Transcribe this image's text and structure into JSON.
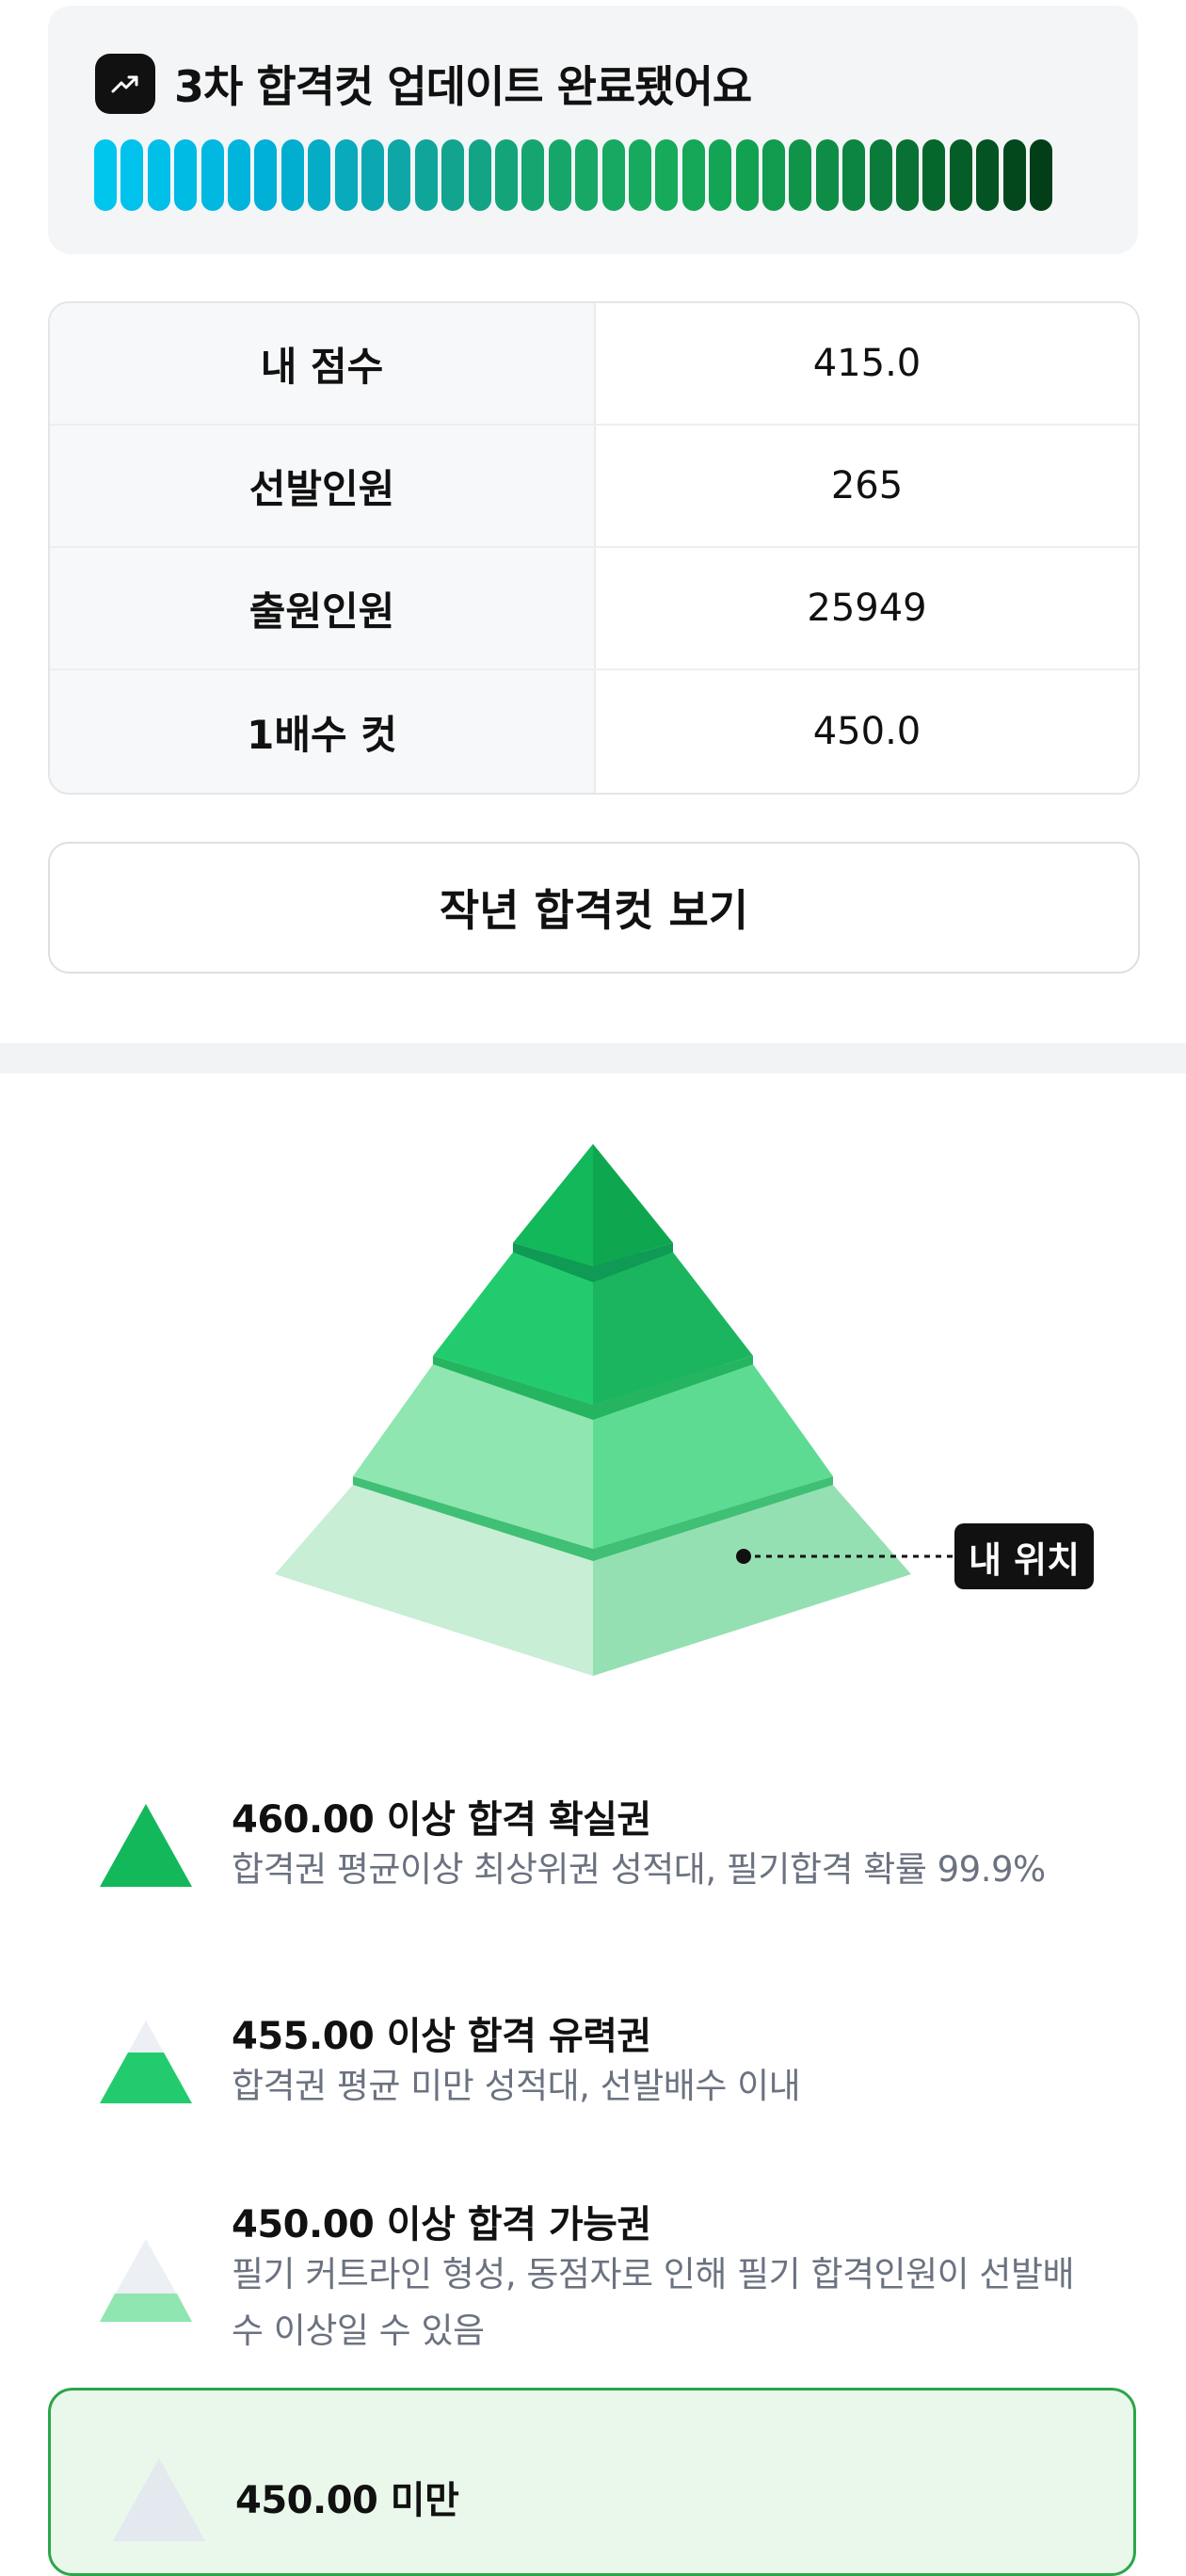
{
  "banner": {
    "icon": "trending-up-icon",
    "title": "3차 합격컷 업데이트 완료됐어요",
    "bar_colors": [
      "#00c6ee",
      "#00c2ec",
      "#00bfe8",
      "#00bbe4",
      "#00b8e0",
      "#00b4dc",
      "#00b0d6",
      "#02aecf",
      "#05acc6",
      "#08aabc",
      "#0ba8b1",
      "#0ea6a6",
      "#10a59a",
      "#12a48f",
      "#13a485",
      "#14a47a",
      "#15a571",
      "#16a66a",
      "#17a865",
      "#17a961",
      "#17aa5e",
      "#16aa5b",
      "#15a758",
      "#14a455",
      "#12a051",
      "#119b4e",
      "#10944a",
      "#0e8d46",
      "#0c8541",
      "#0a7b3a",
      "#087133",
      "#06672c",
      "#055d27",
      "#045322",
      "#03481d",
      "#023e18"
    ]
  },
  "score_table": {
    "rows": [
      {
        "label": "내 점수",
        "value": "415.0"
      },
      {
        "label": "선발인원",
        "value": "265"
      },
      {
        "label": "출원인원",
        "value": "25949"
      },
      {
        "label": "1배수 컷",
        "value": "450.0"
      }
    ]
  },
  "last_year_button": {
    "label": "작년 합격컷 보기"
  },
  "pyramid": {
    "position_label": "내 위치",
    "colors": {
      "top_left": "#12b85a",
      "top_right": "#0ea750",
      "tier2_left": "#22cc6e",
      "tier2_right": "#1bb55f",
      "tier3_left": "#8fe6b0",
      "tier3_right": "#5edb93",
      "base_left": "#c8eed5",
      "base_right": "#95e0b3",
      "band_dark": "#0f9a55",
      "band_mid": "#25b460",
      "band_light": "#3fc074"
    }
  },
  "legend": [
    {
      "title": "460.00 이상 합격 확실권",
      "desc": "합격권 평균이상 최상위권 성적대, 필기합격 확률 99.9%"
    },
    {
      "title": "455.00 이상 합격 유력권",
      "desc": "합격권 평균 미만 성적대, 선발배수 이내"
    },
    {
      "title": "450.00 이상 합격 가능권",
      "desc": "필기 커트라인 형성, 동점자로 인해 필기 합격인원이 선발배수 이상일 수 있음"
    },
    {
      "title": "450.00 미만",
      "desc": ""
    }
  ]
}
